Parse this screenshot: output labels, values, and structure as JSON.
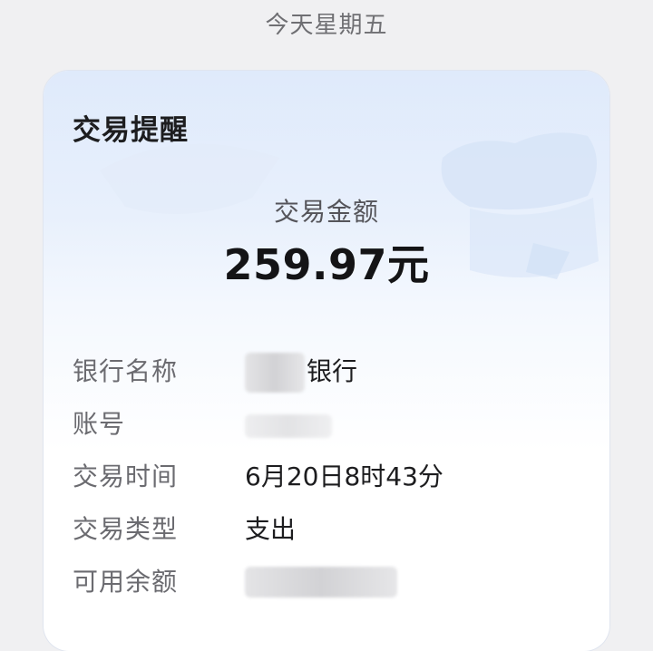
{
  "header": {
    "date_text": "今天星期五"
  },
  "card": {
    "title": "交易提醒",
    "amount_label": "交易金额",
    "amount_value": "259.97元",
    "details": [
      {
        "label": "银行名称",
        "value": "银行"
      },
      {
        "label": "账号",
        "value": ""
      },
      {
        "label": "交易时间",
        "value": "6月20日8时43分"
      },
      {
        "label": "交易类型",
        "value": "支出"
      },
      {
        "label": "可用余额",
        "value": ""
      }
    ]
  },
  "colors": {
    "card_gradient_top": "#dfeafb",
    "title_text": "#1d1d1f",
    "label_text": "#6b6b70"
  }
}
